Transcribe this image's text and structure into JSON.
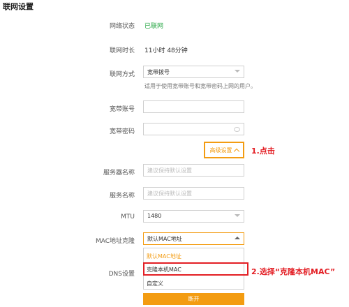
{
  "page": {
    "title": "联网设置"
  },
  "fields": {
    "status": {
      "label": "网络状态",
      "value": "已联网",
      "value_color": "#28a745"
    },
    "duration": {
      "label": "联网时长",
      "value": "11小时 48分钟"
    },
    "method": {
      "label": "联网方式",
      "value": "宽带拨号",
      "hint": "适用于使用宽带账号和宽带密码上网的用户。"
    },
    "account": {
      "label": "宽带账号",
      "value": ""
    },
    "password": {
      "label": "宽带密码",
      "value": ""
    },
    "advanced": {
      "label": "高级设置"
    },
    "server_name": {
      "label": "服务器名称",
      "placeholder": "建议保持默认设置"
    },
    "service_name": {
      "label": "服务名称",
      "placeholder": "建议保持默认设置"
    },
    "mtu": {
      "label": "MTU",
      "value": "1480"
    },
    "mac_clone": {
      "label": "MAC地址克隆",
      "value": "默认MAC地址",
      "options": [
        "默认MAC地址",
        "克隆本机MAC",
        "自定义"
      ]
    },
    "dns": {
      "label": "DNS设置"
    }
  },
  "annotations": {
    "step1": "1.点击",
    "step2": "2.选择“克隆本机MAC”"
  },
  "buttons": {
    "disconnect": "断开"
  },
  "colors": {
    "accent": "#f39c12",
    "annotation": "#e31e24",
    "ok": "#28a745"
  },
  "icons": {
    "password_toggle": "eye-icon",
    "select": "chevron-down-icon",
    "advanced": "chevron-up-icon"
  }
}
